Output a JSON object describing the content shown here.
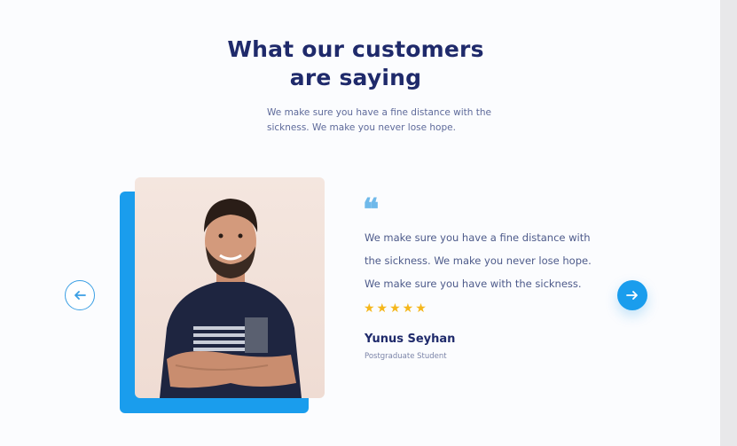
{
  "section": {
    "title_line1": "What our customers",
    "title_line2": "are saying",
    "subtitle": "We make sure you have a fine distance with the sickness. We make you never lose hope."
  },
  "testimonial": {
    "quote_icon": "quote-icon",
    "quote": "We make sure you have a fine distance with the sickness. We make you never lose hope. We make sure you have with the sickness.",
    "rating": 5,
    "stars": "★★★★★",
    "name": "Yunus Seyhan",
    "role": "Postgraduate Student",
    "photo_icon": "customer-photo"
  },
  "navigation": {
    "prev_icon": "arrow-left-icon",
    "next_icon": "arrow-right-icon"
  },
  "colors": {
    "accent": "#1a9ded",
    "heading": "#1f2a6b",
    "star": "#f5b71c",
    "quote_mark": "#6fb9ea"
  }
}
